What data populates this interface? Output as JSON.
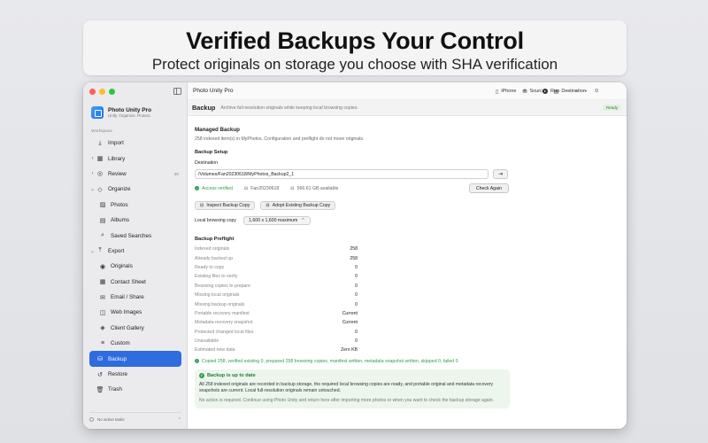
{
  "banner": {
    "title": "Verified Backups Your Control",
    "subtitle": "Protect originals on storage you choose with SHA verification"
  },
  "app": {
    "name": "Photo Unity Pro",
    "tagline": "Unify. Organize. Protect."
  },
  "toolbar": {
    "title": "Photo Unity Pro",
    "iphone_label": "iPhone",
    "sources_label": "Sources",
    "destination_label": "Destination",
    "run_label": "Run"
  },
  "sidebar": {
    "section_label": "Workspace",
    "items": [
      {
        "label": "Import",
        "icon": "import-icon",
        "level": 0,
        "chevron": ""
      },
      {
        "label": "Library",
        "icon": "library-icon",
        "level": 0,
        "chevron": "›"
      },
      {
        "label": "Review",
        "icon": "review-icon",
        "level": 0,
        "chevron": "›",
        "badge": "90"
      },
      {
        "label": "Organize",
        "icon": "tag-icon",
        "level": 0,
        "chevron": "⌄"
      },
      {
        "label": "Photos",
        "icon": "photos-icon",
        "level": 1
      },
      {
        "label": "Albums",
        "icon": "albums-icon",
        "level": 1
      },
      {
        "label": "Saved Searches",
        "icon": "saved-search-icon",
        "level": 1
      },
      {
        "label": "Export",
        "icon": "export-icon",
        "level": 0,
        "chevron": "⌄"
      },
      {
        "label": "Originals",
        "icon": "originals-icon",
        "level": 1
      },
      {
        "label": "Contact Sheet",
        "icon": "contact-sheet-icon",
        "level": 1
      },
      {
        "label": "Email / Share",
        "icon": "email-icon",
        "level": 1
      },
      {
        "label": "Web Images",
        "icon": "web-icon",
        "level": 1
      },
      {
        "label": "Client Gallery",
        "icon": "client-gallery-icon",
        "level": 1
      },
      {
        "label": "Custom",
        "icon": "custom-icon",
        "level": 1
      },
      {
        "label": "Backup",
        "icon": "backup-icon",
        "level": 0,
        "active": true
      },
      {
        "label": "Restore",
        "icon": "restore-icon",
        "level": 0
      },
      {
        "label": "Trash",
        "icon": "trash-icon",
        "level": 0
      }
    ],
    "footer": "No active tasks"
  },
  "header": {
    "title": "Backup",
    "subtitle": "Archive full-resolution originals while keeping local browsing copies.",
    "badge": "Ready"
  },
  "managed": {
    "title": "Managed Backup",
    "description": "258 indexed item(s) in MyPhotos. Configuration and preflight do not move originals."
  },
  "setup": {
    "title": "Backup Setup",
    "destination_label": "Destination",
    "destination_value": "/Volumes/Fan20230618/MyPhotos_Backup2_1",
    "access_status": "Access verified",
    "volume_name": "Fan20230618",
    "available": "566.61 GB available",
    "check_again": "Check Again",
    "inspect_button": "Inspect Backup Copy",
    "adopt_button": "Adopt Existing Backup Copy",
    "local_copy_label": "Local browsing copy",
    "local_copy_value": "1,600 x 1,600 maximum"
  },
  "preflight": {
    "title": "Backup Preflight",
    "rows": [
      {
        "k": "Indexed originals",
        "v": "258"
      },
      {
        "k": "Already backed up",
        "v": "258"
      },
      {
        "k": "Ready to copy",
        "v": "0"
      },
      {
        "k": "Existing files to verify",
        "v": "0"
      },
      {
        "k": "Browsing copies to prepare",
        "v": "0"
      },
      {
        "k": "Missing local originals",
        "v": "0"
      },
      {
        "k": "Missing backup originals",
        "v": "0"
      },
      {
        "k": "Portable recovery manifest",
        "v": "Current"
      },
      {
        "k": "Metadata recovery snapshot",
        "v": "Current"
      },
      {
        "k": "Protected changed local files",
        "v": "0"
      },
      {
        "k": "Unavailable",
        "v": "0"
      },
      {
        "k": "Estimated new data",
        "v": "Zero KB"
      }
    ],
    "summary": "Copied 258, verified existing 0, prepared 258 browsing copies, manifest written, metadata snapshot written, skipped 0, failed 0"
  },
  "result": {
    "title": "Backup is up to date",
    "text": "All 258 indexed originals are recorded in backup storage, the required local browsing copies are ready, and portable original and metadata recovery snapshots are current. Local full-resolution originals remain untouched.",
    "note": "No action is required. Continue using Photo Unity and return here after importing more photos or when you want to check the backup storage again."
  },
  "colors": {
    "accent": "#2e6cdf",
    "success": "#2ea04a",
    "success_bg": "#ecf6ec"
  }
}
